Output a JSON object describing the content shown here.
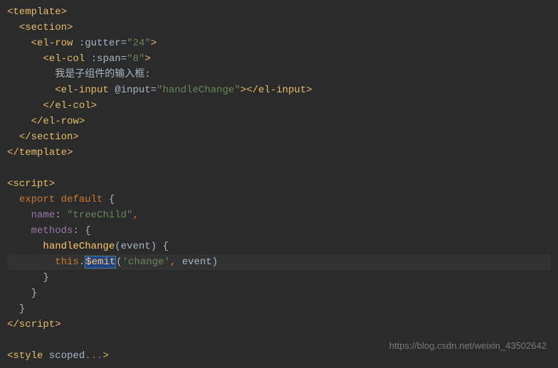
{
  "code": {
    "l1_tag": "<template>",
    "l2_tag": "<section>",
    "l3_open": "<el-row ",
    "l3_attr": ":gutter=",
    "l3_val": "\"24\"",
    "l3_close": ">",
    "l4_open": "<el-col ",
    "l4_attr": ":span=",
    "l4_val": "\"8\"",
    "l4_close": ">",
    "l5_text": "我是子组件的输入框:",
    "l6_open": "<el-input ",
    "l6_attr": "@input=",
    "l6_val": "\"handleChange\"",
    "l6_mid": ">",
    "l6_close": "</el-input>",
    "l7_tag": "</el-col>",
    "l8_tag": "</el-row>",
    "l9_tag": "</section>",
    "l10_tag": "</template>",
    "l12_tag": "<script>",
    "l13_kw1": "export",
    "l13_kw2": "default",
    "l13_brace": " {",
    "l14_prop": "name",
    "l14_colon": ": ",
    "l14_val": "\"treeChild\"",
    "l14_comma": ",",
    "l15_prop": "methods",
    "l15_rest": ": {",
    "l16_fn": "handleChange",
    "l16_paren_open": "(",
    "l16_param": "event",
    "l16_paren_close": ") {",
    "l17_this": "this",
    "l17_dot": ".",
    "l17_emit": "$emit",
    "l17_paren_open": "(",
    "l17_str": "'change'",
    "l17_comma": ", ",
    "l17_arg": "event",
    "l17_paren_close": ")",
    "l18_brace": "}",
    "l19_brace": "}",
    "l20_brace": "}",
    "l21_tag": "</script>",
    "l23_open": "<style ",
    "l23_attr": "scoped",
    "l23_fold": "...",
    "l23_close": ">"
  },
  "watermark": "https://blog.csdn.net/weixin_43502642"
}
